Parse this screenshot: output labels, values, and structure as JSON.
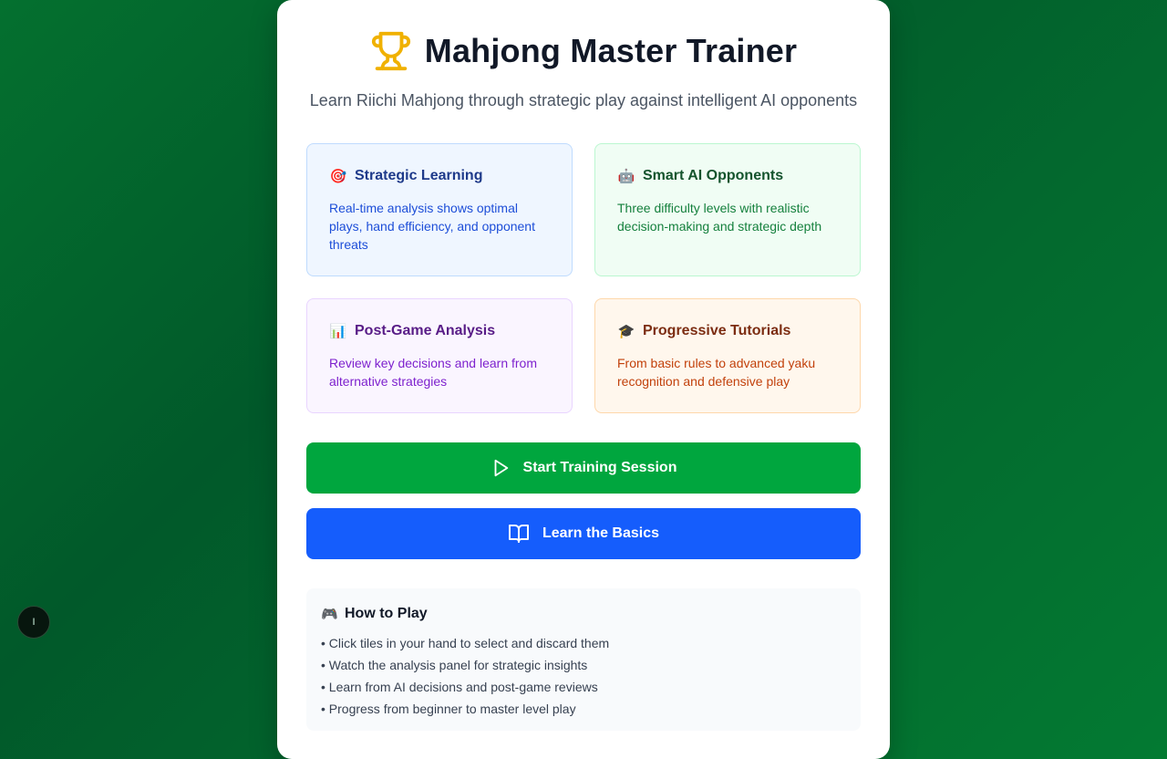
{
  "header": {
    "title": "Mahjong Master Trainer",
    "subtitle": "Learn Riichi Mahjong through strategic play against intelligent AI opponents",
    "icon": "trophy-icon"
  },
  "features": [
    {
      "emoji": "🎯",
      "title": "Strategic Learning",
      "description": "Real-time analysis shows optimal plays, hand efficiency, and opponent threats"
    },
    {
      "emoji": "🤖",
      "title": "Smart AI Opponents",
      "description": "Three difficulty levels with realistic decision-making and strategic depth"
    },
    {
      "emoji": "📊",
      "title": "Post-Game Analysis",
      "description": "Review key decisions and learn from alternative strategies"
    },
    {
      "emoji": "🎓",
      "title": "Progressive Tutorials",
      "description": "From basic rules to advanced yaku recognition and defensive play"
    }
  ],
  "buttons": {
    "start_label": "Start Training Session",
    "learn_label": "Learn the Basics"
  },
  "how_to_play": {
    "emoji": "🎮",
    "title": "How to Play",
    "items": [
      "• Click tiles in your hand to select and discard them",
      "• Watch the analysis panel for strategic insights",
      "• Learn from AI decisions and post-game reviews",
      "• Progress from beginner to master level play"
    ]
  },
  "floating_button": {
    "label": "I"
  },
  "colors": {
    "background": "#01592a",
    "start_button": "#00a63e",
    "learn_button": "#155dfc",
    "trophy": "#f0b100"
  }
}
